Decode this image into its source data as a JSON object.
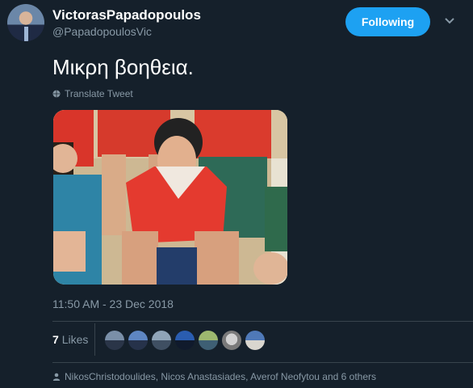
{
  "user": {
    "display_name": "VictorasPapadopoulos",
    "handle": "@PapadopoulosVic"
  },
  "follow_button": "Following",
  "tweet": {
    "text": "Μικρη βοηθεια.",
    "translate_label": "Translate Tweet",
    "timestamp": "11:50 AM - 23 Dec 2018"
  },
  "stats": {
    "likes_count": "7",
    "likes_label": "Likes"
  },
  "liked_by": "NikosChristodoulides, Nicos Anastasiades, Averof Neofytou and 6 others",
  "icons": [
    "chevron-down-icon",
    "globe-icon",
    "person-icon"
  ],
  "colors": {
    "background": "#15202b",
    "accent": "#1da1f2",
    "secondary_text": "#8899a6"
  }
}
